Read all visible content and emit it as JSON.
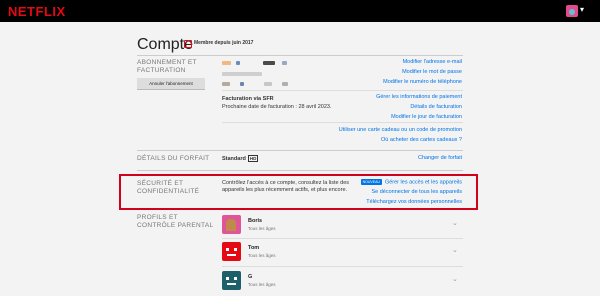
{
  "header": {
    "logo": "NETFLIX"
  },
  "account": {
    "title": "Compte",
    "member_since": "Membre depuis juin 2017"
  },
  "membership": {
    "section_label": "ABONNEMENT ET FACTURATION",
    "cancel_label": "Annuler l'abonnement",
    "links": [
      "Modifier l'adresse e-mail",
      "Modifier le mot de passe",
      "Modifier le numéro de téléphone"
    ],
    "billing_via": "Facturation via SFR",
    "next_billing": "Prochaine date de facturation : 28 avril 2023.",
    "billing_links": [
      "Gérer les informations de paiement",
      "Détails de facturation",
      "Modifier le jour de facturation"
    ],
    "gift_links": [
      "Utiliser une carte cadeau ou un code de promotion",
      "Où acheter des cartes cadeaux ?"
    ]
  },
  "plan": {
    "section_label": "DÉTAILS DU FORFAIT",
    "plan_name": "Standard",
    "badge": "HD",
    "change_label": "Changer de forfait"
  },
  "security": {
    "section_label": "SÉCURITÉ ET CONFIDENTIALITÉ",
    "description_line1": "Contrôlez l'accès à ce compte, consultez la liste des",
    "description_line2": "appareils les plus récemment actifs, et plus encore.",
    "new_badge": "NOUVEAU",
    "links": [
      "Gérer les accès et les appareils",
      "Se déconnecter de tous les appareils",
      "Téléchargez vos données personnelles"
    ]
  },
  "profiles": {
    "section_label": "PROFILS ET CONTRÔLE PARENTAL",
    "items": [
      {
        "name": "Boris",
        "sub": "Tous les âges"
      },
      {
        "name": "Tom",
        "sub": "Tous les âges"
      },
      {
        "name": "G",
        "sub": "Tous les âges"
      }
    ]
  },
  "colors": {
    "brand": "#e50914",
    "link": "#0073e6",
    "highlight": "#d0021b"
  }
}
